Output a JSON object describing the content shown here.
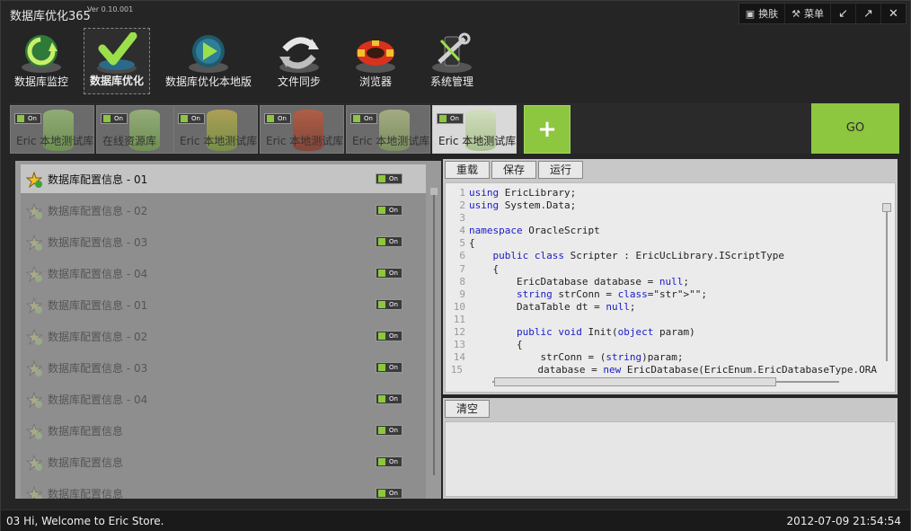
{
  "app": {
    "title": "数据库优化365",
    "version": "Ver 0.10.001"
  },
  "window_controls": {
    "skin": "换肤",
    "menu": "菜单"
  },
  "toolbar": {
    "items": [
      {
        "label": "数据库监控",
        "icon": "globe-refresh-icon"
      },
      {
        "label": "数据库优化",
        "icon": "checkmark-icon"
      },
      {
        "label": "数据库优化本地版",
        "icon": "play-icon"
      },
      {
        "label": "文件同步",
        "icon": "sync-arrows-icon"
      },
      {
        "label": "浏览器",
        "icon": "lifebuoy-icon"
      },
      {
        "label": "系统管理",
        "icon": "tools-icon"
      }
    ],
    "active": "数据库优化"
  },
  "tabs": {
    "toggle_label": "On",
    "items": [
      {
        "label": "Eric 本地测试库"
      },
      {
        "label": "在线资源库"
      },
      {
        "label": "Eric 本地测试库"
      },
      {
        "label": "Eric 本地测试库"
      },
      {
        "label": "Eric 本地测试库"
      },
      {
        "label": "Eric 本地测试库"
      }
    ],
    "add_label": "+",
    "go_label": "GO"
  },
  "config_list": {
    "toggle_label": "On",
    "items": [
      "数据库配置信息 - 01",
      "数据库配置信息 - 02",
      "数据库配置信息 - 03",
      "数据库配置信息 - 04",
      "数据库配置信息 - 01",
      "数据库配置信息 - 02",
      "数据库配置信息 - 03",
      "数据库配置信息 - 04",
      "数据库配置信息",
      "数据库配置信息",
      "数据库配置信息"
    ]
  },
  "editor": {
    "buttons": {
      "reload": "重载",
      "save": "保存",
      "run": "运行"
    },
    "lines": [
      "using EricLibrary;",
      "using System.Data;",
      "",
      "namespace OracleScript",
      "{",
      "    public class Scripter : EricUcLibrary.IScriptType",
      "    {",
      "        EricDatabase database = null;",
      "        string strConn = \"\";",
      "        DataTable dt = null;",
      "",
      "        public void Init(object param)",
      "        {",
      "            strConn = (string)param;",
      "            database = new EricDatabase(EricEnum.EricDatabaseType.ORA"
    ]
  },
  "output": {
    "clear": "清空"
  },
  "status": {
    "message": "03  Hi, Welcome to Eric Store.",
    "datetime": "2012-07-09 21:54:54"
  },
  "colors": {
    "accent": "#8dc63f",
    "background": "#252525"
  }
}
